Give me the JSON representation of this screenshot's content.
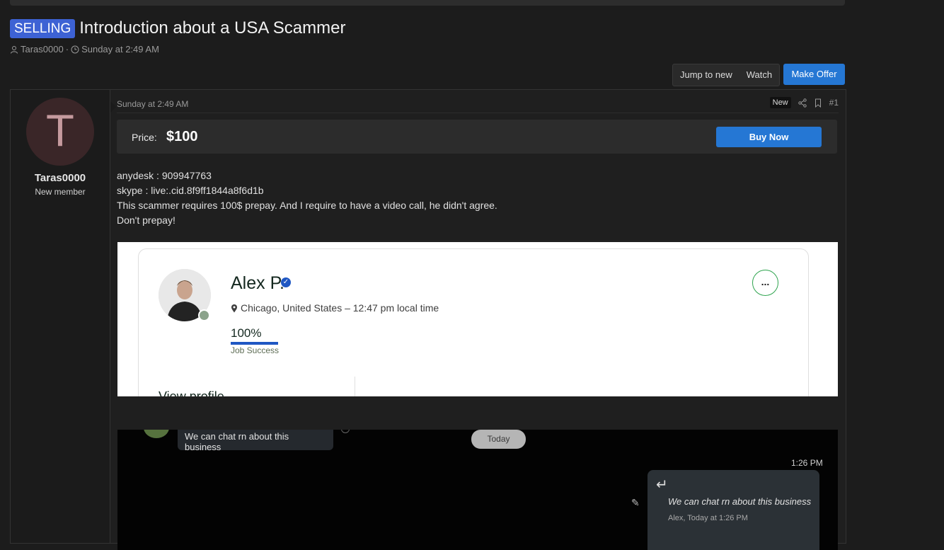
{
  "thread": {
    "prefix": "SELLING",
    "title": "Introduction about a USA Scammer",
    "author": "Taras0000",
    "meta_sep": "·",
    "date": "Sunday at 2:49 AM"
  },
  "toolbar": {
    "jump_to_new": "Jump to new",
    "watch": "Watch",
    "make_offer": "Make Offer"
  },
  "post": {
    "avatar_letter": "T",
    "username": "Taras0000",
    "user_title": "New member",
    "date": "Sunday at 2:49 AM",
    "new_badge": "New",
    "number": "#1",
    "price_label": "Price:",
    "price_value": "$100",
    "buy_now": "Buy Now",
    "body_lines": [
      "anydesk : 909947763",
      "skype : live:.cid.8f9ff1844a8f6d1b",
      "This scammer requires 100$ prepay. And I require to have a video call, he didn't agree.",
      "Don't prepay!"
    ]
  },
  "profile_image": {
    "name": "Alex P.",
    "location": "Chicago, United States – 12:47 pm local time",
    "job_success_pct": "100%",
    "job_success_value": 1.0,
    "job_success_label": "Job Success",
    "view_profile": "View profile",
    "more_icon": "..."
  },
  "chat_image": {
    "incoming_msg": "We can chat rn about this business",
    "day_label": "Today",
    "time": "1:26 PM",
    "outgoing_msg": "We can chat rn about this business",
    "outgoing_meta": "Alex, Today at 1:26 PM"
  },
  "colors": {
    "prefix_bg": "#3d62d4",
    "accent": "#2577d4",
    "verified": "#1f57c3"
  }
}
